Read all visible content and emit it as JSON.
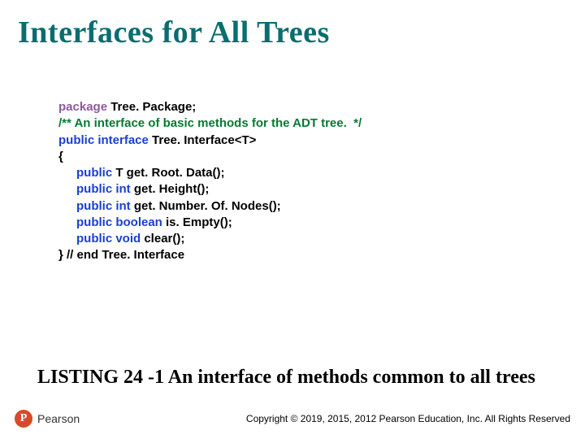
{
  "title": "Interfaces for All Trees",
  "code": {
    "l1a": "package",
    "l1b": " Tree. Package;",
    "l2": "/** An interface of basic methods for the ADT tree.  */",
    "l3a": "public interface",
    "l3b": " Tree. Interface<T>",
    "l4": "{",
    "l5a": "public",
    "l5b": " T get. Root. Data();",
    "l6a": "public int",
    "l6b": " get. Height();",
    "l7a": "public int",
    "l7b": " get. Number. Of. Nodes();",
    "l8a": "public boolean",
    "l8b": " is. Empty();",
    "l9a": "public void",
    "l9b": " clear();",
    "l10": "} // end Tree. Interface"
  },
  "caption": "LISTING 24 -1 An interface of methods common to all trees",
  "footer": {
    "logo_letter": "P",
    "logo_text": "Pearson",
    "copyright": "Copyright © 2019, 2015, 2012 Pearson Education, Inc. All Rights Reserved"
  }
}
